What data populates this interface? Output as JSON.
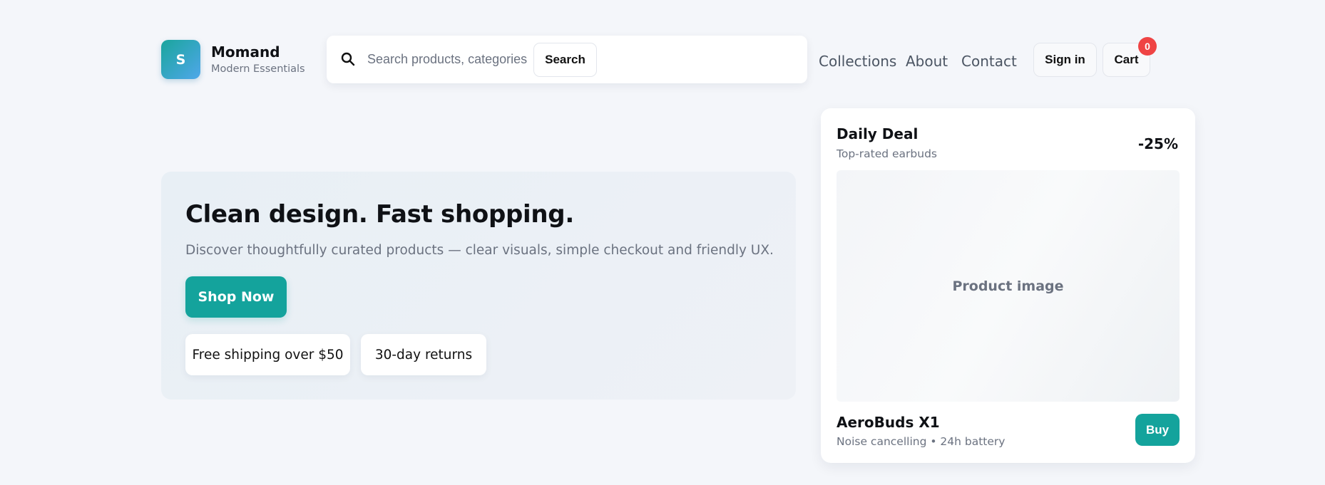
{
  "brand": {
    "logo_letter": "S",
    "name": "Momand",
    "tagline": "Modern Essentials"
  },
  "search": {
    "icon": "search-icon",
    "placeholder": "Search products, categories",
    "value": "",
    "button_label": "Search"
  },
  "nav": {
    "links": [
      "Collections",
      "About",
      "Contact"
    ]
  },
  "account": {
    "signin_label": "Sign in",
    "cart_label": "Cart",
    "cart_count": "0"
  },
  "hero": {
    "title": "Clean design. Fast shopping.",
    "subtitle": "Discover thoughtfully curated products — clear visuals, simple checkout and friendly UX.",
    "cta_label": "Shop Now",
    "features": [
      "Free shipping over $50",
      "30-day returns"
    ]
  },
  "deal": {
    "title": "Daily Deal",
    "subtitle": "Top-rated earbuds",
    "discount": "-25%",
    "image_label": "Product image",
    "product_name": "AeroBuds X1",
    "product_desc": "Noise cancelling • 24h battery",
    "buy_label": "Buy"
  },
  "colors": {
    "page_background": "#f4f6fa",
    "accent": "#14a39c",
    "badge": "#ef4444",
    "muted_text": "#6b7280"
  }
}
